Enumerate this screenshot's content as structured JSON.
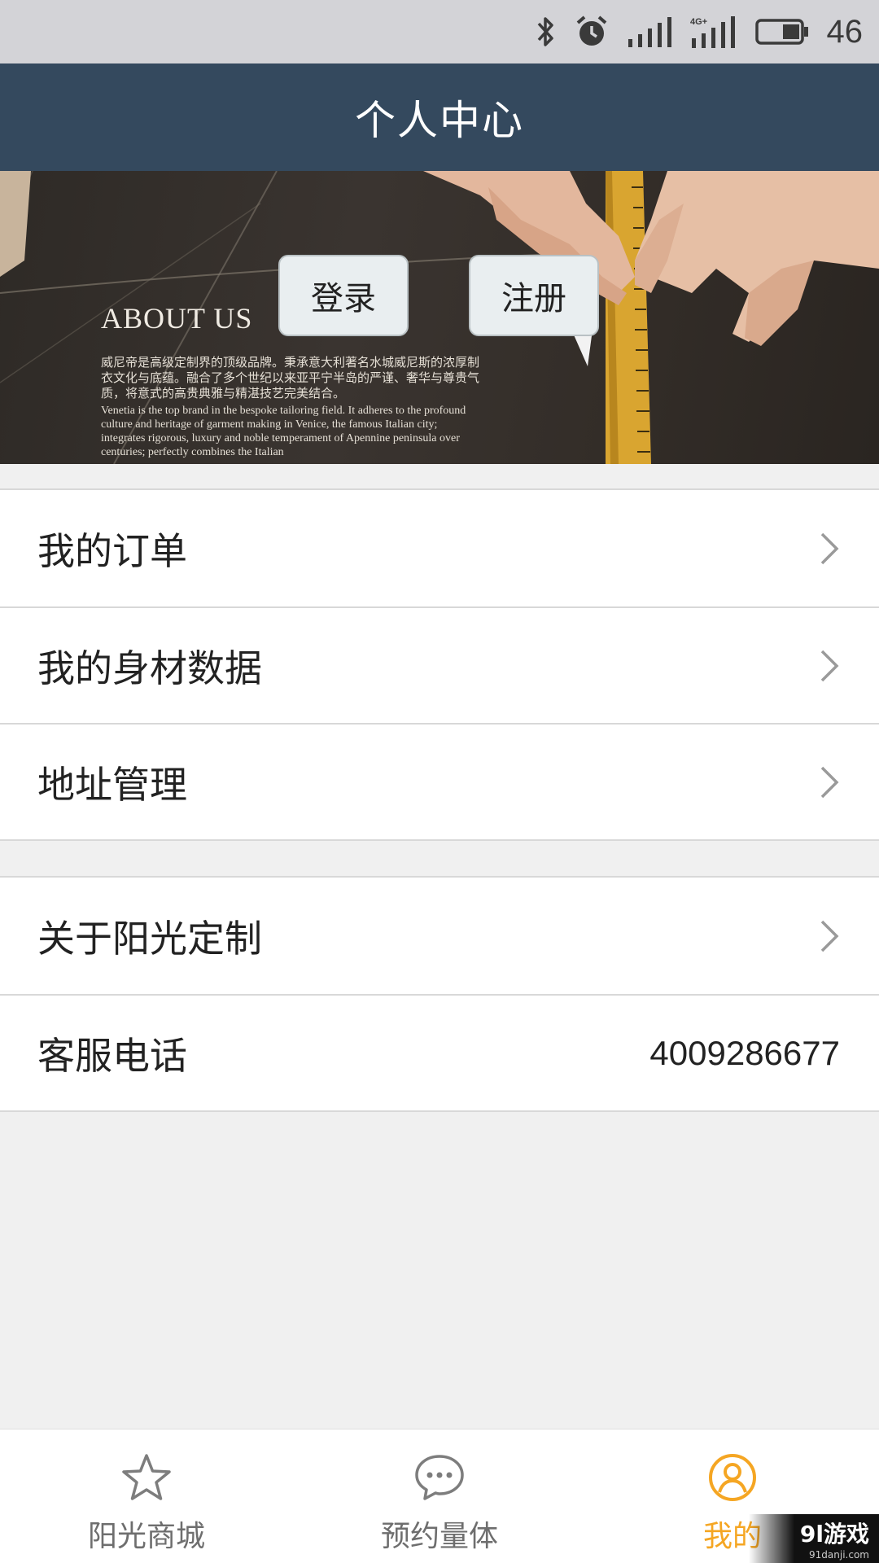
{
  "status_bar": {
    "battery_level": "46",
    "icons": [
      "bluetooth-icon",
      "alarm-icon",
      "signal-icon",
      "signal-4g-icon",
      "battery-icon"
    ]
  },
  "header": {
    "title": "个人中心"
  },
  "banner": {
    "heading": "ABOUT US",
    "text_cn": "威尼帝是高级定制界的顶级品牌。秉承意大利著名水城威尼斯的浓厚制衣文化与底蕴。融合了多个世纪以来亚平宁半岛的严谨、奢华与尊贵气质，将意式的高贵典雅与精湛技艺完美结合。",
    "text_en": "Venetia is the top brand in the bespoke tailoring field. It adheres to the profound culture and heritage of garment making in Venice, the famous Italian city; integrates rigorous, luxury and noble temperament of Apennine peninsula over centuries; perfectly combines the Italian",
    "login_label": "登录",
    "register_label": "注册"
  },
  "menu_group_1": {
    "items": [
      {
        "label": "我的订单"
      },
      {
        "label": "我的身材数据"
      },
      {
        "label": "地址管理"
      }
    ]
  },
  "menu_group_2": {
    "about_label": "关于阳光定制",
    "service_label": "客服电话",
    "service_phone": "4009286677"
  },
  "tab_bar": {
    "tabs": [
      {
        "label": "阳光商城",
        "icon": "star-icon"
      },
      {
        "label": "预约量体",
        "icon": "chat-bubble-icon"
      },
      {
        "label": "我的",
        "icon": "user-icon"
      }
    ],
    "active_index": 2,
    "active_color": "#f5a623"
  },
  "watermark": {
    "brand": "9l游戏",
    "site": "91danji.com"
  },
  "colors": {
    "header_bg": "#34495e",
    "status_bg": "#d3d3d7",
    "page_bg": "#f0f0f0",
    "accent": "#f5a623"
  }
}
